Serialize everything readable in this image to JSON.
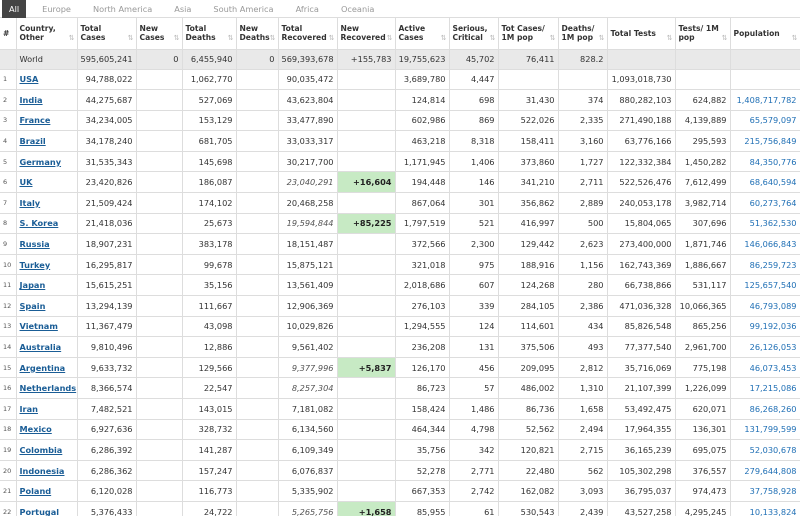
{
  "tabs": [
    "All",
    "Europe",
    "North America",
    "Asia",
    "South America",
    "Africa",
    "Oceania"
  ],
  "active_tab": 0,
  "columns": [
    "#",
    "Country, Other",
    "Total Cases",
    "New Cases",
    "Total Deaths",
    "New Deaths",
    "Total Recovered",
    "New Recovered",
    "Active Cases",
    "Serious, Critical",
    "Tot Cases/ 1M pop",
    "Deaths/ 1M pop",
    "Total Tests",
    "Tests/ 1M pop",
    "Population"
  ],
  "world": [
    "",
    "World",
    "595,605,241",
    "0",
    "6,455,940",
    "0",
    "569,393,678",
    "+155,783",
    "19,755,623",
    "45,702",
    "76,411",
    "828.2",
    "",
    "",
    ""
  ],
  "rows": [
    [
      "1",
      "USA",
      "94,788,022",
      "",
      "1,062,770",
      "",
      "90,035,472",
      "",
      "3,689,780",
      "4,447",
      "",
      "",
      "1,093,018,730",
      "",
      ""
    ],
    [
      "2",
      "India",
      "44,275,687",
      "",
      "527,069",
      "",
      "43,623,804",
      "",
      "124,814",
      "698",
      "31,430",
      "374",
      "880,282,103",
      "624,882",
      "1,408,717,782"
    ],
    [
      "3",
      "France",
      "34,234,005",
      "",
      "153,129",
      "",
      "33,477,890",
      "",
      "602,986",
      "869",
      "522,026",
      "2,335",
      "271,490,188",
      "4,139,889",
      "65,579,097"
    ],
    [
      "4",
      "Brazil",
      "34,178,240",
      "",
      "681,705",
      "",
      "33,033,317",
      "",
      "463,218",
      "8,318",
      "158,411",
      "3,160",
      "63,776,166",
      "295,593",
      "215,756,849"
    ],
    [
      "5",
      "Germany",
      "31,535,343",
      "",
      "145,698",
      "",
      "30,217,700",
      "",
      "1,171,945",
      "1,406",
      "373,860",
      "1,727",
      "122,332,384",
      "1,450,282",
      "84,350,776"
    ],
    [
      "6",
      "UK",
      "23,420,826",
      "",
      "186,087",
      "",
      "23,040,291",
      "+16,604",
      "194,448",
      "146",
      "341,210",
      "2,711",
      "522,526,476",
      "7,612,499",
      "68,640,594"
    ],
    [
      "7",
      "Italy",
      "21,509,424",
      "",
      "174,102",
      "",
      "20,468,258",
      "",
      "867,064",
      "301",
      "356,862",
      "2,889",
      "240,053,178",
      "3,982,714",
      "60,273,764"
    ],
    [
      "8",
      "S. Korea",
      "21,418,036",
      "",
      "25,673",
      "",
      "19,594,844",
      "+85,225",
      "1,797,519",
      "521",
      "416,997",
      "500",
      "15,804,065",
      "307,696",
      "51,362,530"
    ],
    [
      "9",
      "Russia",
      "18,907,231",
      "",
      "383,178",
      "",
      "18,151,487",
      "",
      "372,566",
      "2,300",
      "129,442",
      "2,623",
      "273,400,000",
      "1,871,746",
      "146,066,843"
    ],
    [
      "10",
      "Turkey",
      "16,295,817",
      "",
      "99,678",
      "",
      "15,875,121",
      "",
      "321,018",
      "975",
      "188,916",
      "1,156",
      "162,743,369",
      "1,886,667",
      "86,259,723"
    ],
    [
      "11",
      "Japan",
      "15,615,251",
      "",
      "35,156",
      "",
      "13,561,409",
      "",
      "2,018,686",
      "607",
      "124,268",
      "280",
      "66,738,866",
      "531,117",
      "125,657,540"
    ],
    [
      "12",
      "Spain",
      "13,294,139",
      "",
      "111,667",
      "",
      "12,906,369",
      "",
      "276,103",
      "339",
      "284,105",
      "2,386",
      "471,036,328",
      "10,066,365",
      "46,793,089"
    ],
    [
      "13",
      "Vietnam",
      "11,367,479",
      "",
      "43,098",
      "",
      "10,029,826",
      "",
      "1,294,555",
      "124",
      "114,601",
      "434",
      "85,826,548",
      "865,256",
      "99,192,036"
    ],
    [
      "14",
      "Australia",
      "9,810,496",
      "",
      "12,886",
      "",
      "9,561,402",
      "",
      "236,208",
      "131",
      "375,506",
      "493",
      "77,377,540",
      "2,961,700",
      "26,126,053"
    ],
    [
      "15",
      "Argentina",
      "9,633,732",
      "",
      "129,566",
      "",
      "9,377,996",
      "+5,837",
      "126,170",
      "456",
      "209,095",
      "2,812",
      "35,716,069",
      "775,198",
      "46,073,453"
    ],
    [
      "16",
      "Netherlands",
      "8,366,574",
      "",
      "22,547",
      "",
      "8,257,304",
      "",
      "86,723",
      "57",
      "486,002",
      "1,310",
      "21,107,399",
      "1,226,099",
      "17,215,086"
    ],
    [
      "17",
      "Iran",
      "7,482,521",
      "",
      "143,015",
      "",
      "7,181,082",
      "",
      "158,424",
      "1,486",
      "86,736",
      "1,658",
      "53,492,475",
      "620,071",
      "86,268,260"
    ],
    [
      "18",
      "Mexico",
      "6,927,636",
      "",
      "328,732",
      "",
      "6,134,560",
      "",
      "464,344",
      "4,798",
      "52,562",
      "2,494",
      "17,964,355",
      "136,301",
      "131,799,599"
    ],
    [
      "19",
      "Colombia",
      "6,286,392",
      "",
      "141,287",
      "",
      "6,109,349",
      "",
      "35,756",
      "342",
      "120,821",
      "2,715",
      "36,165,239",
      "695,075",
      "52,030,678"
    ],
    [
      "20",
      "Indonesia",
      "6,286,362",
      "",
      "157,247",
      "",
      "6,076,837",
      "",
      "52,278",
      "2,771",
      "22,480",
      "562",
      "105,302,298",
      "376,557",
      "279,644,808"
    ],
    [
      "21",
      "Poland",
      "6,120,028",
      "",
      "116,773",
      "",
      "5,335,902",
      "",
      "667,353",
      "2,742",
      "162,082",
      "3,093",
      "36,795,037",
      "974,473",
      "37,758,928"
    ],
    [
      "22",
      "Portugal",
      "5,376,433",
      "",
      "24,722",
      "",
      "5,265,756",
      "+1,658",
      "85,955",
      "61",
      "530,543",
      "2,439",
      "43,527,258",
      "4,295,245",
      "10,133,824"
    ]
  ],
  "italic_recovered_rows": [
    6,
    8,
    15,
    16,
    22
  ],
  "colors": {
    "new_recovered_bg": "#c7eac4",
    "population_text": "#1f6fb5",
    "country_link": "#1a5d96"
  }
}
